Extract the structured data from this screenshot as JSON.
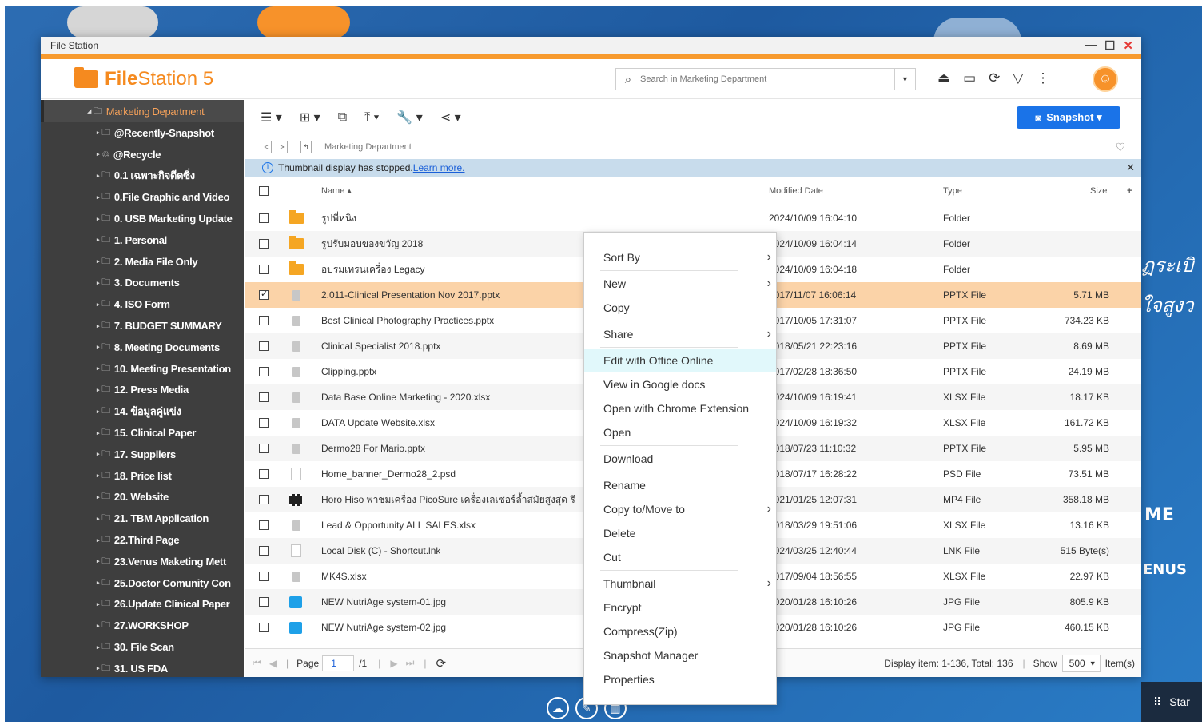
{
  "window": {
    "title": "File Station"
  },
  "app": {
    "name_bold": "File",
    "name_rest": "Station 5"
  },
  "search": {
    "placeholder": "Search in Marketing Department"
  },
  "toolbar": {
    "snapshot_label": "Snapshot ▾"
  },
  "path": {
    "current": "Marketing Department"
  },
  "info": {
    "text": "Thumbnail display has stopped.",
    "link": "Learn more."
  },
  "columns": {
    "name": "Name ▴",
    "modified": "Modified Date",
    "type": "Type",
    "size": "Size"
  },
  "sidebar": {
    "root": "Marketing Department",
    "items": [
      "@Recently-Snapshot",
      "@Recycle",
      "0.1 เฉพาะกิจดีดซิ่ง",
      "0.File Graphic and Video",
      "0. USB Marketing Update",
      "1. Personal",
      "2. Media File Only",
      "3. Documents",
      "4. ISO Form",
      "7. BUDGET SUMMARY",
      "8. Meeting Documents",
      "10. Meeting Presentation",
      "12. Press Media",
      "14. ข้อมูลคู่แข่ง",
      "15. Clinical Paper",
      "17. Suppliers",
      "18. Price list",
      "20. Website",
      "21. TBM Application",
      "22.Third Page",
      "23.Venus Maketing Mett",
      "25.Doctor Comunity Con",
      "26.Update Clinical Paper",
      "27.WORKSHOP",
      "30. File Scan",
      "31. US FDA"
    ]
  },
  "files": [
    {
      "name": "รูปพี่หนิง",
      "date": "2024/10/09 16:04:10",
      "type": "Folder",
      "size": "",
      "icon": "folder"
    },
    {
      "name": "รูปรับมอบของขวัญ 2018",
      "date": "2024/10/09 16:04:14",
      "type": "Folder",
      "size": "",
      "icon": "folder"
    },
    {
      "name": "อบรมเทรนเครื่อง Legacy",
      "date": "2024/10/09 16:04:18",
      "type": "Folder",
      "size": "",
      "icon": "folder"
    },
    {
      "name": "2.011-Clinical Presentation Nov 2017.pptx",
      "date": "2017/11/07 16:06:14",
      "type": "PPTX File",
      "size": "5.71 MB",
      "icon": "doc",
      "selected": true
    },
    {
      "name": "Best Clinical Photography Practices.pptx",
      "date": "2017/10/05 17:31:07",
      "type": "PPTX File",
      "size": "734.23 KB",
      "icon": "doc"
    },
    {
      "name": "Clinical Specialist 2018.pptx",
      "date": "2018/05/21 22:23:16",
      "type": "PPTX File",
      "size": "8.69 MB",
      "icon": "doc"
    },
    {
      "name": "Clipping.pptx",
      "date": "2017/02/28 18:36:50",
      "type": "PPTX File",
      "size": "24.19 MB",
      "icon": "doc"
    },
    {
      "name": "Data Base Online Marketing - 2020.xlsx",
      "date": "2024/10/09 16:19:41",
      "type": "XLSX File",
      "size": "18.17 KB",
      "icon": "doc"
    },
    {
      "name": "DATA Update Website.xlsx",
      "date": "2024/10/09 16:19:32",
      "type": "XLSX File",
      "size": "161.72 KB",
      "icon": "doc"
    },
    {
      "name": "Dermo28 For Mario.pptx",
      "date": "2018/07/23 11:10:32",
      "type": "PPTX File",
      "size": "5.95 MB",
      "icon": "doc"
    },
    {
      "name": "Home_banner_Dermo28_2.psd",
      "date": "2018/07/17 16:28:22",
      "type": "PSD File",
      "size": "73.51 MB",
      "icon": "blank"
    },
    {
      "name": "Horo Hiso พาชมเครื่อง PicoSure เครื่องเลเซอร์ล้ำสมัยสูงสุด รี",
      "date": "2021/01/25 12:07:31",
      "type": "MP4 File",
      "size": "358.18 MB",
      "icon": "video"
    },
    {
      "name": "Lead & Opportunity ALL SALES.xlsx",
      "date": "2018/03/29 19:51:06",
      "type": "XLSX File",
      "size": "13.16 KB",
      "icon": "doc"
    },
    {
      "name": "Local Disk (C) - Shortcut.lnk",
      "date": "2024/03/25 12:40:44",
      "type": "LNK File",
      "size": "515 Byte(s)",
      "icon": "blank"
    },
    {
      "name": "MK4S.xlsx",
      "date": "2017/09/04 18:56:55",
      "type": "XLSX File",
      "size": "22.97 KB",
      "icon": "doc"
    },
    {
      "name": "NEW NutriAge system-01.jpg",
      "date": "2020/01/28 16:10:26",
      "type": "JPG File",
      "size": "805.9 KB",
      "icon": "img"
    },
    {
      "name": "NEW NutriAge system-02.jpg",
      "date": "2020/01/28 16:10:26",
      "type": "JPG File",
      "size": "460.15 KB",
      "icon": "img"
    }
  ],
  "footer": {
    "page_label": "Page",
    "page": "1",
    "total_pages": "/1",
    "display": "Display item: 1-136, Total: 136",
    "show_label": "Show",
    "show_value": "500",
    "items_label": "Item(s)"
  },
  "context_menu": [
    {
      "label": "Sort By",
      "sub": true
    },
    {
      "sep": true
    },
    {
      "label": "New",
      "sub": true
    },
    {
      "label": "Copy"
    },
    {
      "sep": true
    },
    {
      "label": "Share",
      "sub": true
    },
    {
      "sep": true
    },
    {
      "label": "Edit with Office Online",
      "hl": true
    },
    {
      "label": "View in Google docs"
    },
    {
      "label": "Open with Chrome Extension"
    },
    {
      "label": "Open"
    },
    {
      "sep": true
    },
    {
      "label": "Download"
    },
    {
      "sep": true
    },
    {
      "label": "Rename"
    },
    {
      "label": "Copy to/Move to",
      "sub": true
    },
    {
      "label": "Delete"
    },
    {
      "label": "Cut"
    },
    {
      "sep": true
    },
    {
      "label": "Thumbnail",
      "sub": true
    },
    {
      "label": "Encrypt"
    },
    {
      "label": "Compress(Zip)"
    },
    {
      "label": "Snapshot Manager"
    },
    {
      "label": "Properties"
    }
  ],
  "background": {
    "text1": "ฏระเบิ",
    "text2": "ใจสูงว",
    "text3": "ME",
    "text4": "ENUS",
    "start": "Star"
  }
}
